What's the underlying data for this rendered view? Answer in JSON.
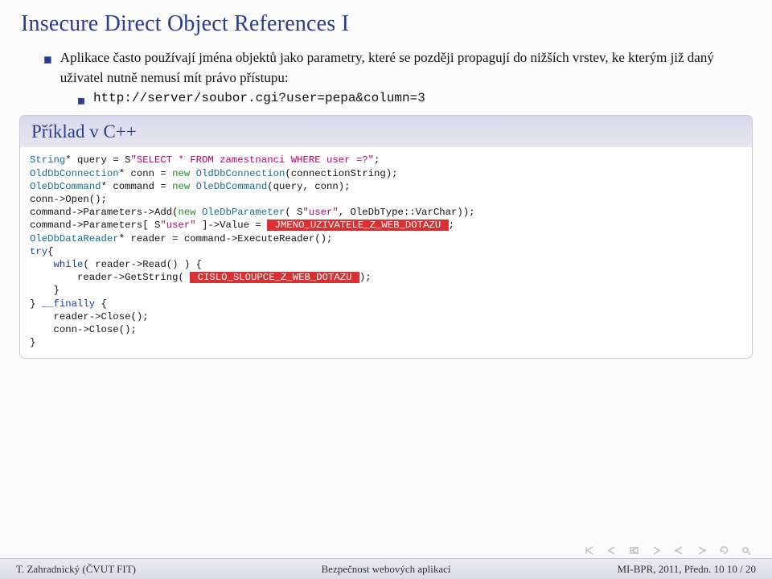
{
  "title": "Insecure Direct Object References I",
  "bullet": "Aplikace často používají jména objektů jako parametry, které se později propagují do nižších vrstev, ke kterým již daný uživatel nutně nemusí mít právo přístupu:",
  "sub_url": "http://server/soubor.cgi?user=pepa&column=3",
  "example_title": "Příklad v C++",
  "code": {
    "l1a": "String",
    "l1b": "* query = S",
    "l1c": "\"SELECT * FROM zamestnanci WHERE user =?\"",
    "l1d": ";",
    "l2a": "OldDbConnection",
    "l2b": "* conn = ",
    "l2c": "new ",
    "l2d": "OldDbConnection",
    "l2e": "(connectionString);",
    "l3a": "OleDbCommand",
    "l3b": "* command = ",
    "l3c": "new ",
    "l3d": "OleDbCommand",
    "l3e": "(query, conn);",
    "l4": "conn->Open();",
    "l5a": "command->Parameters->Add(",
    "l5b": "new ",
    "l5c": "OleDbParameter",
    "l5d": "( S",
    "l5e": "\"user\"",
    "l5f": ", OleDbType::VarChar));",
    "l6a": "command->Parameters[ S",
    "l6b": "\"user\"",
    "l6c": " ]->Value = ",
    "l6d": " JMENO_UZIVATELE_Z_WEB_DOTAZU ",
    "l6e": ";",
    "l7a": "OleDbDataReader",
    "l7b": "* reader = command->ExecuteReader();",
    "l8a": "try",
    "l8b": "{",
    "l9a": "    ",
    "l9b": "while",
    "l9c": "( reader->Read() ) {",
    "l10a": "        reader->GetString( ",
    "l10b": " CISLO_SLOUPCE_Z_WEB_DOTAZU ",
    "l10c": ");",
    "l11": "    }",
    "l12a": "} ",
    "l12b": "__finally ",
    "l12c": "{",
    "l13": "    reader->Close();",
    "l14": "    conn->Close();",
    "l15": "}"
  },
  "footer": {
    "left": "T. Zahradnický (ČVUT FIT)",
    "center": "Bezpečnost webových aplikací",
    "right": "MI-BPR, 2011, Předn. 10    10 / 20"
  }
}
